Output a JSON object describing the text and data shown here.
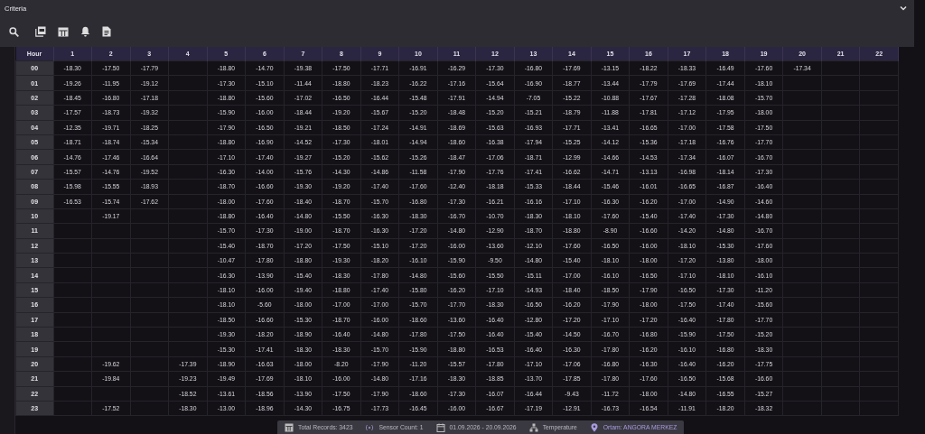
{
  "panel": {
    "title": "Criteria"
  },
  "table": {
    "hour_column": "Hour",
    "columns": [
      "1",
      "2",
      "3",
      "4",
      "5",
      "6",
      "7",
      "8",
      "9",
      "10",
      "11",
      "12",
      "13",
      "14",
      "15",
      "16",
      "17",
      "18",
      "19",
      "20",
      "21",
      "22"
    ],
    "rows": [
      {
        "hour": "00",
        "cells": [
          "-18.30",
          "-17.50",
          "-17.79",
          null,
          "-18.80",
          "-14.70",
          "-19.38",
          "-17.50",
          "-17.71",
          "-16.91",
          "-16.29",
          "-17.30",
          "-16.80",
          "-17.69",
          "-13.15",
          "-18.22",
          "-18.33",
          "-16.49",
          "-17.60",
          "-17.34",
          null,
          null
        ]
      },
      {
        "hour": "01",
        "cells": [
          "-19.26",
          "-11.95",
          "-19.12",
          null,
          "-17.30",
          "-15.10",
          "-11.44",
          "-18.80",
          "-18.23",
          "-16.22",
          "-17.16",
          "-15.64",
          "-16.90",
          "-18.77",
          "-13.44",
          "-17.79",
          "-17.69",
          "-17.44",
          "-18.10",
          null,
          null,
          null
        ]
      },
      {
        "hour": "02",
        "cells": [
          "-18.45",
          "-16.80",
          "-17.18",
          null,
          "-18.80",
          "-15.60",
          "-17.02",
          "-16.50",
          "-16.44",
          "-15.48",
          "-17.91",
          "-14.94",
          "-7.05",
          "-15.22",
          "-10.88",
          "-17.67",
          "-17.28",
          "-18.08",
          "-15.70",
          null,
          null,
          null
        ]
      },
      {
        "hour": "03",
        "cells": [
          "-17.57",
          "-18.73",
          "-19.32",
          null,
          "-15.90",
          "-16.00",
          "-18.44",
          "-19.20",
          "-15.67",
          "-15.20",
          "-18.48",
          "-15.20",
          "-15.21",
          "-18.79",
          "-11.88",
          "-17.81",
          "-17.12",
          "-17.95",
          "-18.00",
          null,
          null,
          null
        ]
      },
      {
        "hour": "04",
        "cells": [
          "-12.35",
          "-19.71",
          "-18.25",
          null,
          "-17.90",
          "-16.50",
          "-19.21",
          "-18.50",
          "-17.24",
          "-14.91",
          "-18.69",
          "-15.63",
          "-16.93",
          "-17.71",
          "-13.41",
          "-16.65",
          "-17.00",
          "-17.58",
          "-17.50",
          null,
          null,
          null
        ]
      },
      {
        "hour": "05",
        "cells": [
          "-18.71",
          "-18.74",
          "-15.34",
          null,
          "-18.80",
          "-16.90",
          "-14.52",
          "-17.30",
          "-18.01",
          "-14.94",
          "-18.60",
          "-16.38",
          "-17.94",
          "-15.25",
          "-14.12",
          "-15.36",
          "-17.18",
          "-16.76",
          "-17.70",
          null,
          null,
          null
        ]
      },
      {
        "hour": "06",
        "cells": [
          "-14.76",
          "-17.46",
          "-16.64",
          null,
          "-17.10",
          "-17.40",
          "-19.27",
          "-15.20",
          "-15.62",
          "-15.26",
          "-18.47",
          "-17.06",
          "-18.71",
          "-12.99",
          "-14.66",
          "-14.53",
          "-17.34",
          "-16.07",
          "-16.70",
          null,
          null,
          null
        ]
      },
      {
        "hour": "07",
        "cells": [
          "-15.57",
          "-14.76",
          "-19.52",
          null,
          "-16.30",
          "-14.00",
          "-15.76",
          "-14.30",
          "-14.86",
          "-11.58",
          "-17.90",
          "-17.76",
          "-17.41",
          "-16.62",
          "-14.71",
          "-13.13",
          "-16.98",
          "-18.14",
          "-17.30",
          null,
          null,
          null
        ]
      },
      {
        "hour": "08",
        "cells": [
          "-15.98",
          "-15.55",
          "-18.93",
          null,
          "-18.70",
          "-16.60",
          "-19.30",
          "-19.20",
          "-17.40",
          "-17.60",
          "-12.40",
          "-18.18",
          "-15.33",
          "-18.44",
          "-15.46",
          "-16.01",
          "-16.65",
          "-16.87",
          "-16.40",
          null,
          null,
          null
        ]
      },
      {
        "hour": "09",
        "cells": [
          "-16.53",
          "-15.74",
          "-17.62",
          null,
          "-18.00",
          "-17.60",
          "-18.40",
          "-18.70",
          "-15.70",
          "-16.80",
          "-17.30",
          "-16.21",
          "-16.16",
          "-17.10",
          "-16.30",
          "-16.20",
          "-17.00",
          "-14.90",
          "-14.60",
          null,
          null,
          null
        ]
      },
      {
        "hour": "10",
        "cells": [
          null,
          "-19.17",
          null,
          null,
          "-18.80",
          "-16.40",
          "-14.80",
          "-15.50",
          "-16.30",
          "-18.30",
          "-16.70",
          "-10.70",
          "-18.30",
          "-18.10",
          "-17.60",
          "-15.40",
          "-17.40",
          "-17.30",
          "-14.80",
          null,
          null,
          null
        ]
      },
      {
        "hour": "11",
        "cells": [
          null,
          null,
          null,
          null,
          "-15.70",
          "-17.30",
          "-19.00",
          "-18.70",
          "-16.30",
          "-17.20",
          "-14.80",
          "-12.90",
          "-18.70",
          "-18.80",
          "-8.90",
          "-16.60",
          "-14.20",
          "-14.80",
          "-16.70",
          null,
          null,
          null
        ]
      },
      {
        "hour": "12",
        "cells": [
          null,
          null,
          null,
          null,
          "-15.40",
          "-18.70",
          "-17.20",
          "-17.50",
          "-15.10",
          "-17.20",
          "-16.00",
          "-13.60",
          "-12.10",
          "-17.60",
          "-16.50",
          "-16.00",
          "-18.10",
          "-15.30",
          "-17.60",
          null,
          null,
          null
        ]
      },
      {
        "hour": "13",
        "cells": [
          null,
          null,
          null,
          null,
          "-10.47",
          "-17.80",
          "-18.80",
          "-19.30",
          "-18.20",
          "-16.10",
          "-15.90",
          "-9.50",
          "-14.80",
          "-15.40",
          "-18.10",
          "-18.00",
          "-17.20",
          "-13.80",
          "-18.00",
          null,
          null,
          null
        ]
      },
      {
        "hour": "14",
        "cells": [
          null,
          null,
          null,
          null,
          "-16.30",
          "-13.90",
          "-15.40",
          "-18.30",
          "-17.80",
          "-14.80",
          "-15.60",
          "-15.50",
          "-15.11",
          "-17.00",
          "-16.10",
          "-16.50",
          "-17.10",
          "-18.10",
          "-16.10",
          null,
          null,
          null
        ]
      },
      {
        "hour": "15",
        "cells": [
          null,
          null,
          null,
          null,
          "-18.10",
          "-16.00",
          "-19.40",
          "-18.80",
          "-17.40",
          "-15.80",
          "-16.20",
          "-17.10",
          "-14.93",
          "-18.40",
          "-18.50",
          "-17.90",
          "-16.50",
          "-17.30",
          "-11.20",
          null,
          null,
          null
        ]
      },
      {
        "hour": "16",
        "cells": [
          null,
          null,
          null,
          null,
          "-18.10",
          "-5.60",
          "-18.00",
          "-17.00",
          "-17.00",
          "-15.70",
          "-17.70",
          "-18.30",
          "-16.50",
          "-16.20",
          "-17.90",
          "-18.00",
          "-17.50",
          "-17.40",
          "-15.60",
          null,
          null,
          null
        ]
      },
      {
        "hour": "17",
        "cells": [
          null,
          null,
          null,
          null,
          "-18.50",
          "-16.60",
          "-15.30",
          "-18.70",
          "-16.00",
          "-18.60",
          "-13.60",
          "-16.40",
          "-12.80",
          "-17.20",
          "-17.10",
          "-17.20",
          "-16.40",
          "-17.80",
          "-17.70",
          null,
          null,
          null
        ]
      },
      {
        "hour": "18",
        "cells": [
          null,
          null,
          null,
          null,
          "-19.30",
          "-18.20",
          "-18.90",
          "-16.40",
          "-14.80",
          "-17.80",
          "-17.50",
          "-16.40",
          "-15.40",
          "-14.50",
          "-16.70",
          "-16.80",
          "-15.90",
          "-17.50",
          "-15.20",
          null,
          null,
          null
        ]
      },
      {
        "hour": "19",
        "cells": [
          null,
          null,
          null,
          null,
          "-15.30",
          "-17.41",
          "-18.30",
          "-18.30",
          "-15.70",
          "-15.90",
          "-18.80",
          "-16.53",
          "-16.40",
          "-16.30",
          "-17.80",
          "-16.20",
          "-16.10",
          "-16.80",
          "-18.30",
          null,
          null,
          null
        ]
      },
      {
        "hour": "20",
        "cells": [
          null,
          "-19.62",
          null,
          "-17.39",
          "-18.90",
          "-16.63",
          "-18.00",
          "-8.20",
          "-17.90",
          "-11.20",
          "-15.57",
          "-17.80",
          "-17.10",
          "-17.06",
          "-16.80",
          "-16.30",
          "-16.40",
          "-16.20",
          "-17.75",
          null,
          null,
          null
        ]
      },
      {
        "hour": "21",
        "cells": [
          null,
          "-19.84",
          null,
          "-19.23",
          "-19.49",
          "-17.69",
          "-18.10",
          "-16.00",
          "-14.80",
          "-17.16",
          "-18.30",
          "-18.85",
          "-13.70",
          "-17.85",
          "-17.80",
          "-17.60",
          "-16.50",
          "-15.68",
          "-16.60",
          null,
          null,
          null
        ]
      },
      {
        "hour": "22",
        "cells": [
          null,
          null,
          null,
          "-18.52",
          "-13.61",
          "-18.56",
          "-13.90",
          "-17.50",
          "-17.90",
          "-18.60",
          "-17.30",
          "-16.07",
          "-16.44",
          "-9.43",
          "-11.72",
          "-18.00",
          "-14.80",
          "-16.55",
          "-15.27",
          null,
          null,
          null
        ]
      },
      {
        "hour": "23",
        "cells": [
          null,
          "-17.52",
          null,
          "-18.30",
          "-13.00",
          "-18.96",
          "-14.30",
          "-16.75",
          "-17.73",
          "-16.45",
          "-16.00",
          "-16.67",
          "-17.19",
          "-12.91",
          "-16.73",
          "-16.54",
          "-11.91",
          "-18.20",
          "-18.32",
          null,
          null,
          null
        ]
      }
    ]
  },
  "status_bar": [
    {
      "kind": "records",
      "text": "Total Records: 3423"
    },
    {
      "kind": "sensors",
      "text": "Sensor Count: 1"
    },
    {
      "kind": "dates",
      "text": "01.09.2026 - 20.09.2026"
    },
    {
      "kind": "measure",
      "text": "Temperature"
    },
    {
      "kind": "location",
      "text": "Ortam: ANGORA MERKEZ"
    }
  ]
}
